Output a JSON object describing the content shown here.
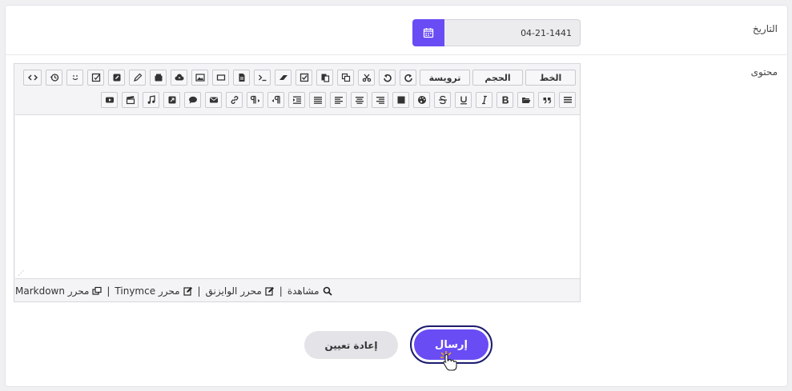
{
  "form": {
    "date_label": "التاريخ",
    "date_value": "04-21-1441",
    "content_label": "محتوى"
  },
  "toolbar": {
    "font_label": "الخط",
    "size_label": "الحجم",
    "heading_label": "ترويسة"
  },
  "editor_footer": {
    "preview": "مشاهدة",
    "wysiwyg": "محرر الوايزنق",
    "tinymce": "محرر Tinymce",
    "markdown": "محرر Markdown",
    "separator": "|"
  },
  "actions": {
    "submit_label": "إرسال",
    "reset_label": "إعادة تعيين"
  },
  "colors": {
    "accent": "#6a4cf5",
    "submit_outline": "#1c1c6e"
  }
}
